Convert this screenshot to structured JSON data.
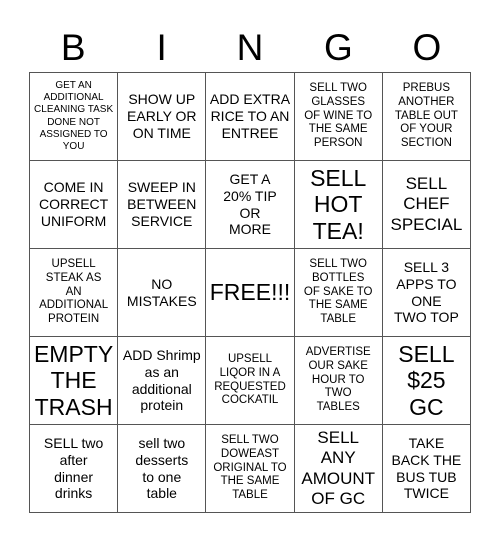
{
  "header": {
    "letters": [
      "B",
      "I",
      "N",
      "G",
      "O"
    ]
  },
  "grid": {
    "columns": 5,
    "rows": 5,
    "cells": [
      {
        "text": "GET AN\nADDITIONAL\nCLEANING TASK\nDONE NOT\nASSIGNED TO\nYOU",
        "size": "xs"
      },
      {
        "text": "SHOW UP\nEARLY OR\nON TIME",
        "size": "md"
      },
      {
        "text": "ADD EXTRA\nRICE TO AN\nENTREE",
        "size": "md"
      },
      {
        "text": "SELL TWO\nGLASSES\nOF WINE TO\nTHE SAME\nPERSON",
        "size": "sm"
      },
      {
        "text": "PREBUS\nANOTHER\nTABLE OUT\nOF YOUR\nSECTION",
        "size": "sm"
      },
      {
        "text": "COME IN\nCORRECT\nUNIFORM",
        "size": "md"
      },
      {
        "text": "SWEEP IN\nBETWEEN\nSERVICE",
        "size": "md"
      },
      {
        "text": "GET A\n20% TIP\nOR\nMORE",
        "size": "md"
      },
      {
        "text": "SELL\nHOT\nTEA!",
        "size": "xxl"
      },
      {
        "text": "SELL\nCHEF\nSPECIAL",
        "size": "lg"
      },
      {
        "text": "UPSELL\nSTEAK AS\nAN\nADDITIONAL\nPROTEIN",
        "size": "sm"
      },
      {
        "text": "NO\nMISTAKES",
        "size": "md"
      },
      {
        "text": "FREE!!!",
        "size": "xxl"
      },
      {
        "text": "SELL TWO\nBOTTLES\nOF SAKE TO\nTHE SAME\nTABLE",
        "size": "sm"
      },
      {
        "text": "SELL 3\nAPPS TO\nONE\nTWO TOP",
        "size": "md"
      },
      {
        "text": "EMPTY\nTHE\nTRASH",
        "size": "xxl"
      },
      {
        "text": "ADD Shrimp\nas an\nadditional\nprotein",
        "size": "md"
      },
      {
        "text": "UPSELL\nLIQOR IN A\nREQUESTED\nCOCKATIL",
        "size": "sm"
      },
      {
        "text": "ADVERTISE\nOUR SAKE\nHOUR TO\nTWO\nTABLES",
        "size": "sm"
      },
      {
        "text": "SELL\n$25\nGC",
        "size": "xxl"
      },
      {
        "text": "SELL two\nafter\ndinner\ndrinks",
        "size": "md"
      },
      {
        "text": "sell two\ndesserts\nto one\ntable",
        "size": "md"
      },
      {
        "text": "SELL TWO\nDOWEAST\nORIGINAL TO\nTHE SAME\nTABLE",
        "size": "sm"
      },
      {
        "text": "SELL\nANY\nAMOUNT\nOF GC",
        "size": "lg"
      },
      {
        "text": "TAKE\nBACK THE\nBUS TUB\nTWICE",
        "size": "md"
      }
    ]
  },
  "colors": {
    "background": "#ffffff",
    "text": "#000000",
    "border": "#555555"
  }
}
